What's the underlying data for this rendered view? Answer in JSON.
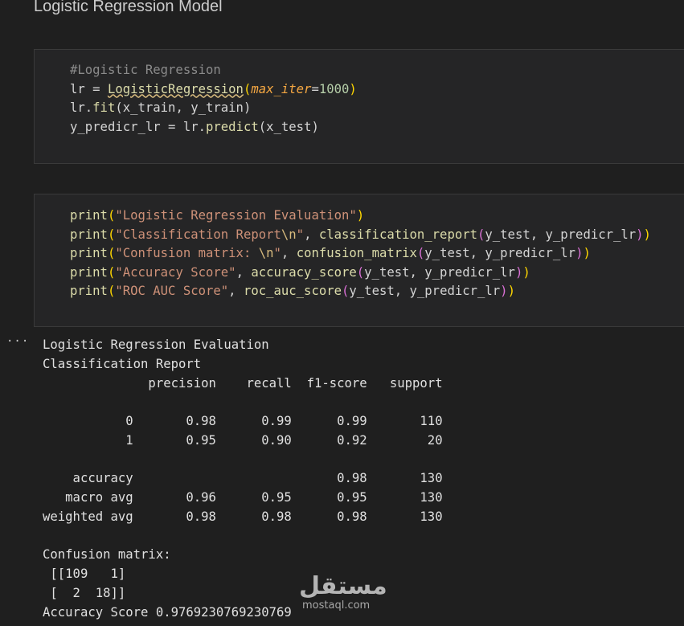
{
  "heading": "Logistic Regression Model",
  "cell1": {
    "comment": "#Logistic Regression",
    "l2_var": "lr",
    "l2_eq": " = ",
    "l2_class": "LogisticRegression",
    "l2_open": "(",
    "l2_param": "max_iter",
    "l2_peq": "=",
    "l2_num": "1000",
    "l2_close": ")",
    "l3_obj": "lr.",
    "l3_fn": "fit",
    "l3_args": "(x_train, y_train)",
    "l4_var": "y_predicr_lr",
    "l4_eq": " = ",
    "l4_obj": "lr.",
    "l4_fn": "predict",
    "l4_args": "(x_test)"
  },
  "cell2": {
    "print": "print",
    "l1_str": "\"Logistic Regression Evaluation\"",
    "l2_str_a": "\"Classification Report",
    "l2_esc": "\\n",
    "l2_str_b": "\"",
    "l2_fn": "classification_report",
    "l2_args": "y_test, y_predicr_lr",
    "l3_str_a": "\"Confusion matrix: ",
    "l3_esc": "\\n",
    "l3_str_b": "\"",
    "l3_fn": "confusion_matrix",
    "l3_args": "y_test, y_predicr_lr",
    "l4_str": "\"Accuracy Score\"",
    "l4_fn": "accuracy_score",
    "l4_args": "y_test, y_predicr_lr",
    "l5_str": "\"ROC AUC Score\"",
    "l5_fn": "roc_auc_score",
    "l5_args": "y_test, y_predicr_lr"
  },
  "output": {
    "more": "···",
    "lines": [
      "Logistic Regression Evaluation",
      "Classification Report",
      "              precision    recall  f1-score   support",
      "",
      "           0       0.98      0.99      0.99       110",
      "           1       0.95      0.90      0.92        20",
      "",
      "    accuracy                           0.98       130",
      "   macro avg       0.96      0.95      0.95       130",
      "weighted avg       0.98      0.98      0.98       130",
      "",
      "Confusion matrix:",
      " [[109   1]",
      " [  2  18]]",
      "Accuracy Score 0.9769230769230769"
    ]
  },
  "watermark": {
    "arabic": "مستقل",
    "latin": "mostaql.com"
  }
}
